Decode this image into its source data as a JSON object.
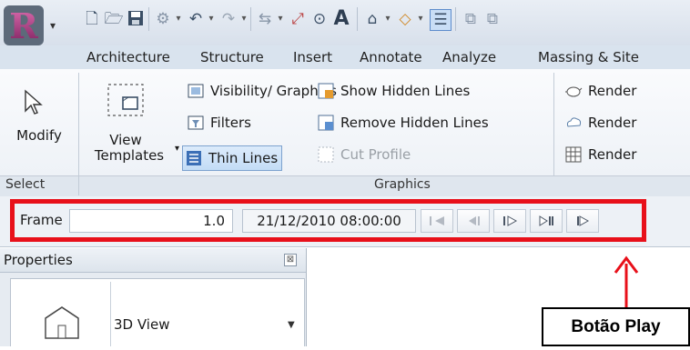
{
  "tabs": [
    "Architecture",
    "Structure",
    "Insert",
    "Annotate",
    "Analyze",
    "Massing & Site"
  ],
  "ribbon": {
    "modify_label": "Modify",
    "view_templates_line1": "View",
    "view_templates_line2": "Templates",
    "visibility_graphics": "Visibility/ Graphics",
    "filters": "Filters",
    "thin_lines": "Thin Lines",
    "show_hidden_lines": "Show Hidden Lines",
    "remove_hidden_lines": "Remove Hidden Lines",
    "cut_profile": "Cut Profile",
    "render_1": "Render",
    "render_2": "Render",
    "render_3": "Render"
  },
  "panels": {
    "select": "Select",
    "graphics": "Graphics"
  },
  "frame": {
    "label": "Frame",
    "value": "1.0",
    "timestamp": "21/12/2010 08:00:00"
  },
  "playback_buttons": [
    "first-frame-icon",
    "previous-key-frame-icon",
    "previous-frame-icon",
    "next-frame-icon",
    "play-icon"
  ],
  "properties": {
    "title": "Properties",
    "type_name": "3D View",
    "close_glyph": "⊠"
  },
  "annotation": {
    "callout": "Botão Play",
    "color": "#e8101a"
  },
  "colors": {
    "accent_blue": "#3b6fb6",
    "highlight": "#c3dcf6",
    "annotation_red": "#e8101a"
  }
}
